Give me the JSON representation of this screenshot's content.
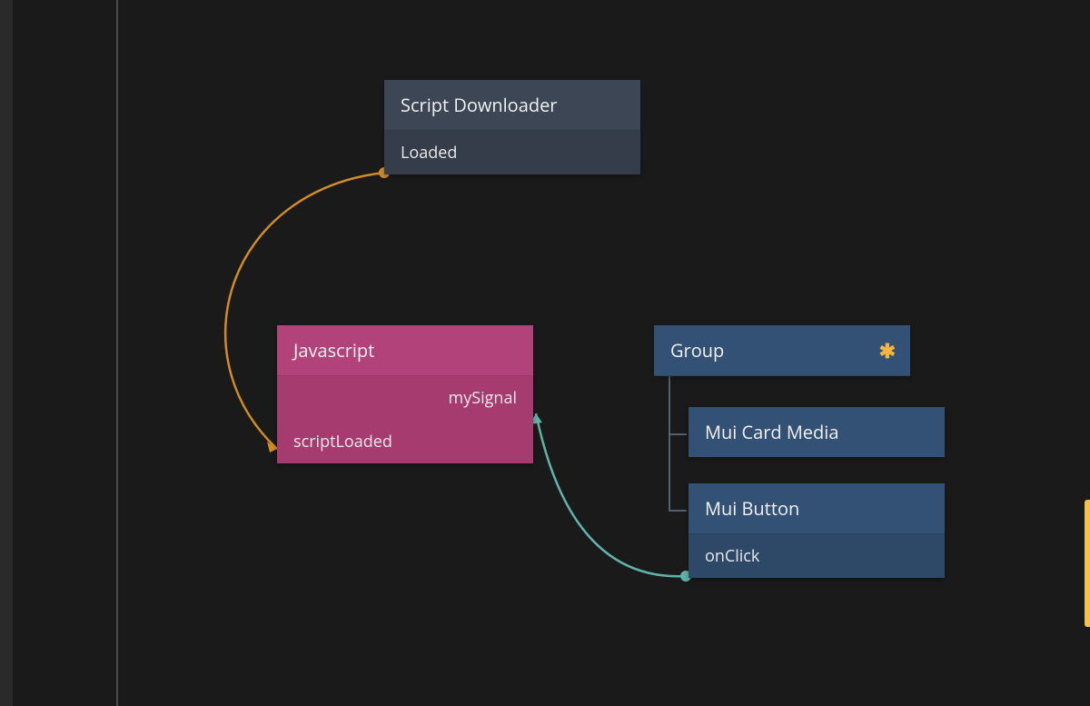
{
  "nodes": {
    "scriptDownloader": {
      "title": "Script Downloader",
      "outputs": {
        "loaded": "Loaded"
      }
    },
    "javascript": {
      "title": "Javascript",
      "inputs": {
        "scriptLoaded": "scriptLoaded",
        "mySignal": "mySignal"
      }
    },
    "group": {
      "title": "Group",
      "hasStar": true
    },
    "muiCardMedia": {
      "title": "Mui Card Media"
    },
    "muiButton": {
      "title": "Mui Button",
      "outputs": {
        "onClick": "onClick"
      }
    }
  },
  "edges": [
    {
      "from": "scriptDownloader.loaded",
      "to": "javascript.scriptLoaded",
      "color": "#d08b2a"
    },
    {
      "from": "muiButton.onClick",
      "to": "javascript.mySignal",
      "color": "#5fb3a8"
    }
  ],
  "colors": {
    "bg": "#1a1a1a",
    "darkNode": "#3c4654",
    "pinkNode": "#b2427a",
    "blueNode": "#335175",
    "edgeOrange": "#d08b2a",
    "edgeTeal": "#5fb3a8",
    "accent": "#f5c242"
  }
}
